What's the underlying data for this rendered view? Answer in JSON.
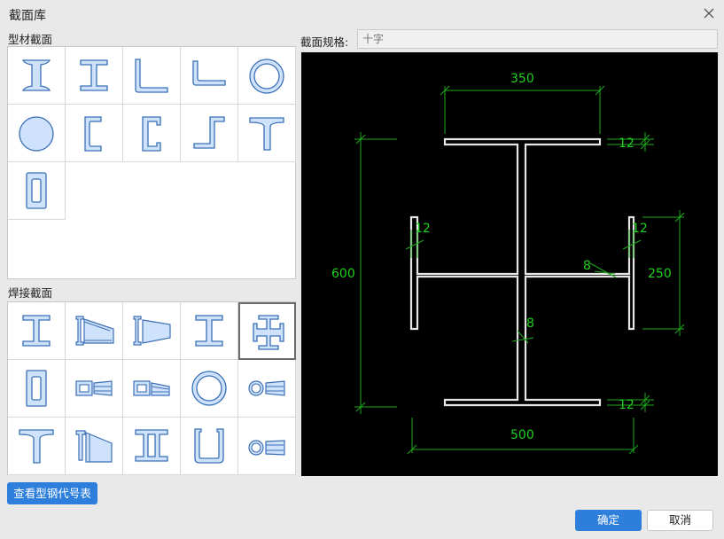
{
  "dialog": {
    "title": "截面库"
  },
  "section_profile": {
    "label": "型材截面"
  },
  "section_welded": {
    "label": "焊接截面"
  },
  "spec": {
    "label": "截面规格:",
    "placeholder": "十字"
  },
  "buttons": {
    "lookup": "查看型钢代号表",
    "ok": "确定",
    "cancel": "取消"
  },
  "drawing": {
    "dim_top": "350",
    "dim_bottom": "500",
    "dim_left": "600",
    "dim_right": "250",
    "thk_top_flange": "12",
    "thk_bottom_flange": "12",
    "thk_left_flange": "12",
    "thk_right_flange": "12",
    "thk_horizontal_web": "8",
    "thk_vertical_web": "8"
  },
  "colors": {
    "accent": "#2e7fdc",
    "shape_fill": "#cfe2fb",
    "shape_stroke": "#3b6fb6",
    "dim": "#1fd11f"
  }
}
